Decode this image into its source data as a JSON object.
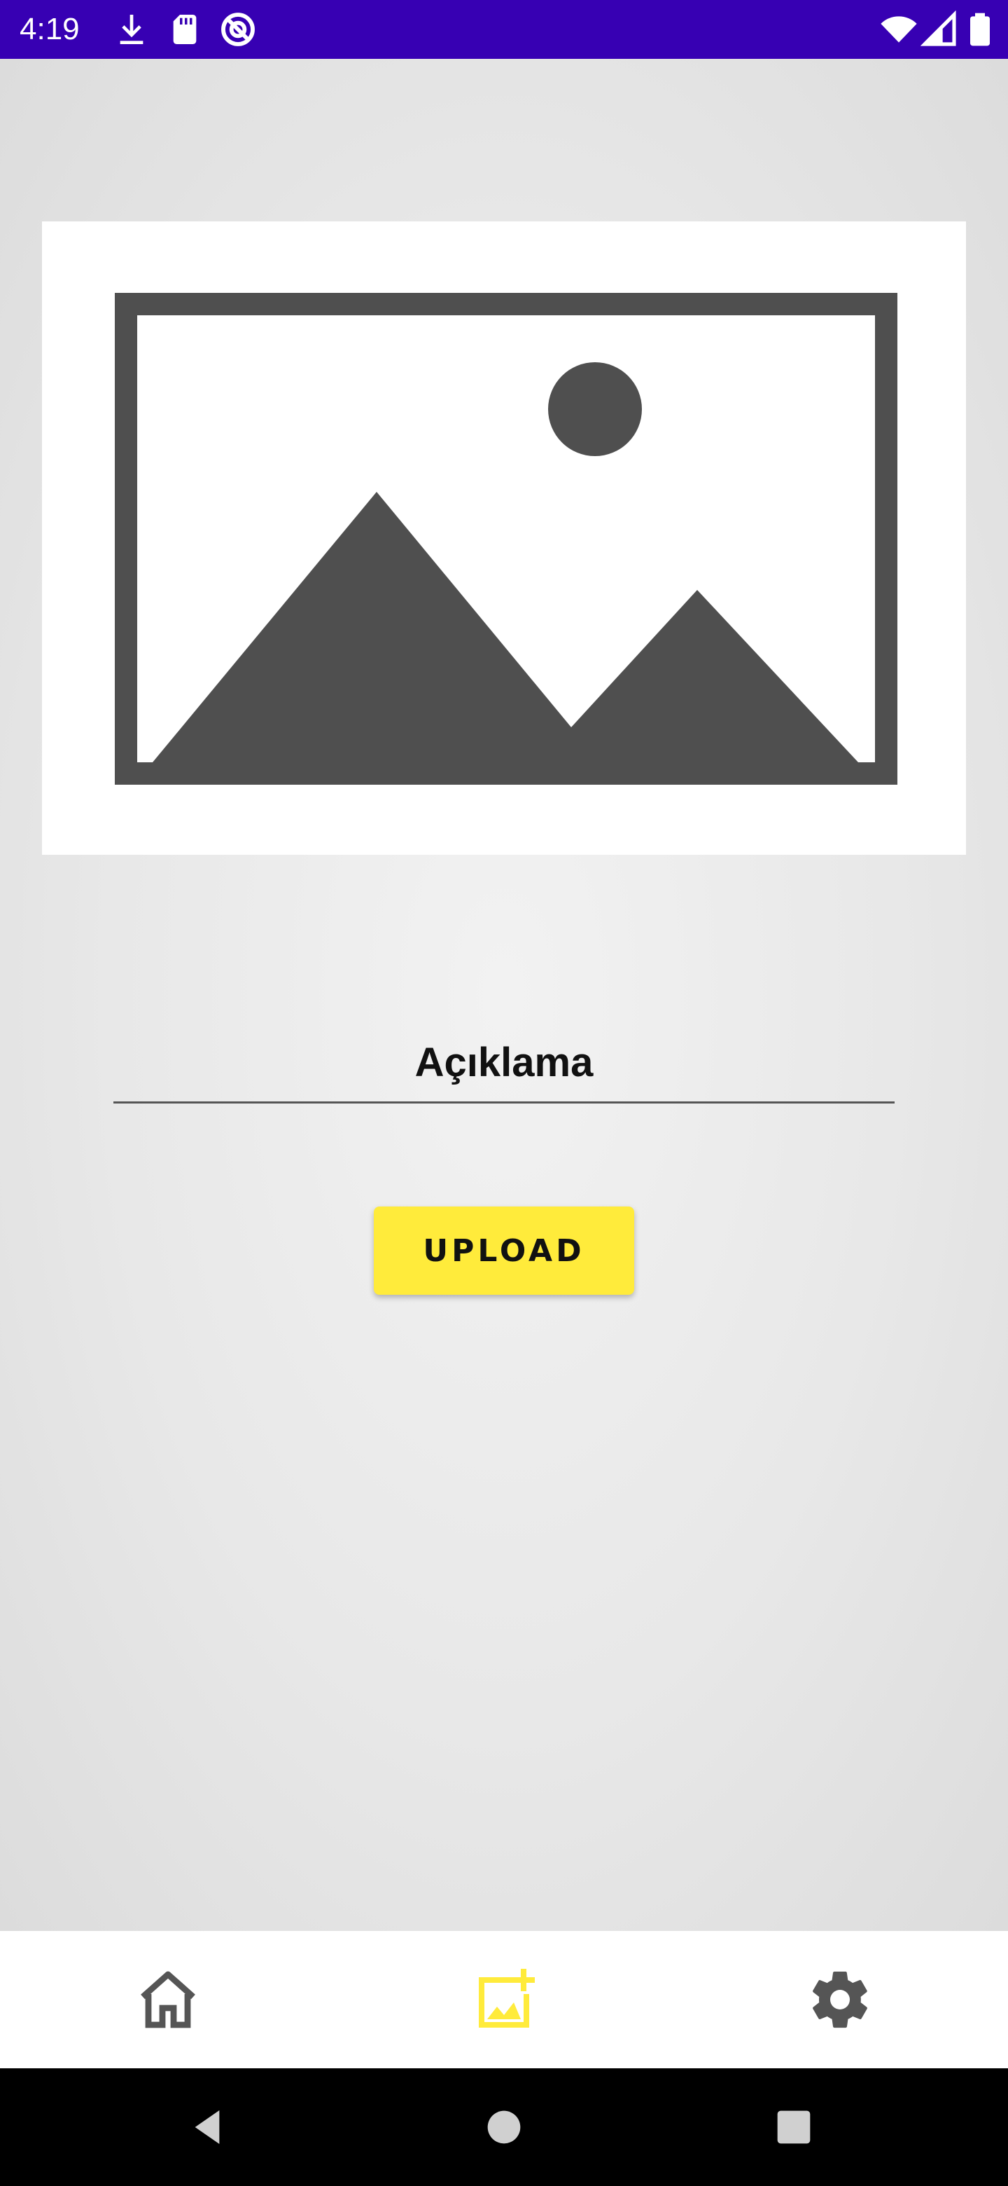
{
  "status_bar": {
    "time": "4:19",
    "background_color": "#3700b3",
    "left_icons": [
      "download-icon",
      "sd-card-icon",
      "data-saver-icon"
    ],
    "right_icons": [
      "wifi-icon",
      "cellular-signal-icon",
      "battery-icon"
    ]
  },
  "image_placeholder": {
    "icon": "image-placeholder-icon"
  },
  "description_field": {
    "placeholder": "Açıklama"
  },
  "upload_button": {
    "label": "UPLOAD",
    "color": "#ffeb3b"
  },
  "bottom_nav": {
    "items": [
      {
        "icon": "home-icon",
        "active": false
      },
      {
        "icon": "add-photo-icon",
        "active": true
      },
      {
        "icon": "settings-gear-icon",
        "active": false
      }
    ],
    "active_color": "#ffeb3b",
    "inactive_color": "#555555"
  },
  "system_nav": {
    "buttons": [
      "back-icon",
      "home-circle-icon",
      "recents-icon"
    ]
  }
}
